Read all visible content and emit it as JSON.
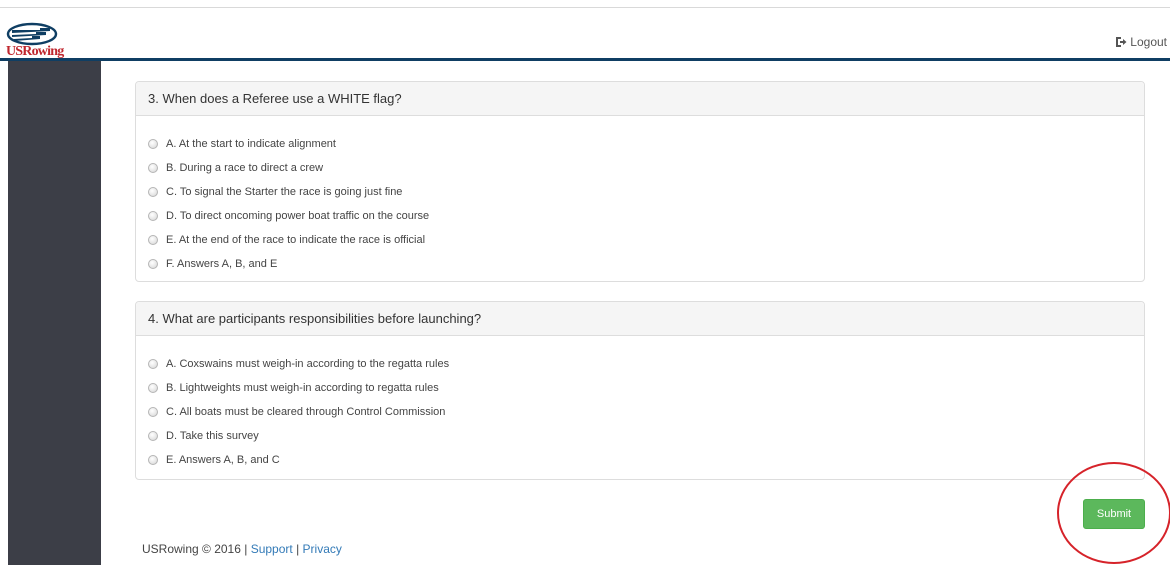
{
  "brand": {
    "logo_text": "USRowing",
    "logo_icon": "usrowing-logo-icon",
    "logo_color": "#c0262d",
    "navy": "#0f3e63"
  },
  "header": {
    "logout_label": "Logout",
    "logout_icon": "sign-out-icon"
  },
  "questions": [
    {
      "title": "3. When does a Referee use a WHITE flag?",
      "options": [
        "A. At the start to indicate alignment",
        "B. During a race to direct a crew",
        "C. To signal the Starter the race is going just fine",
        "D. To direct oncoming power boat traffic on the course",
        "E. At the end of the race to indicate the race is official",
        "F. Answers A, B, and E"
      ]
    },
    {
      "title": "4. What are participants responsibilities before launching?",
      "options": [
        "A. Coxswains must weigh-in according to the regatta rules",
        "B. Lightweights must weigh-in according to regatta rules",
        "C. All boats must be cleared through Control Commission",
        "D. Take this survey",
        "E. Answers A, B, and C"
      ]
    }
  ],
  "actions": {
    "submit_label": "Submit",
    "submit_color": "#5cb85c"
  },
  "footer": {
    "copyright": "USRowing © 2016 |",
    "separator": "|",
    "support_label": "Support",
    "privacy_label": "Privacy"
  },
  "annotation": {
    "highlight_color": "#d6232a"
  }
}
